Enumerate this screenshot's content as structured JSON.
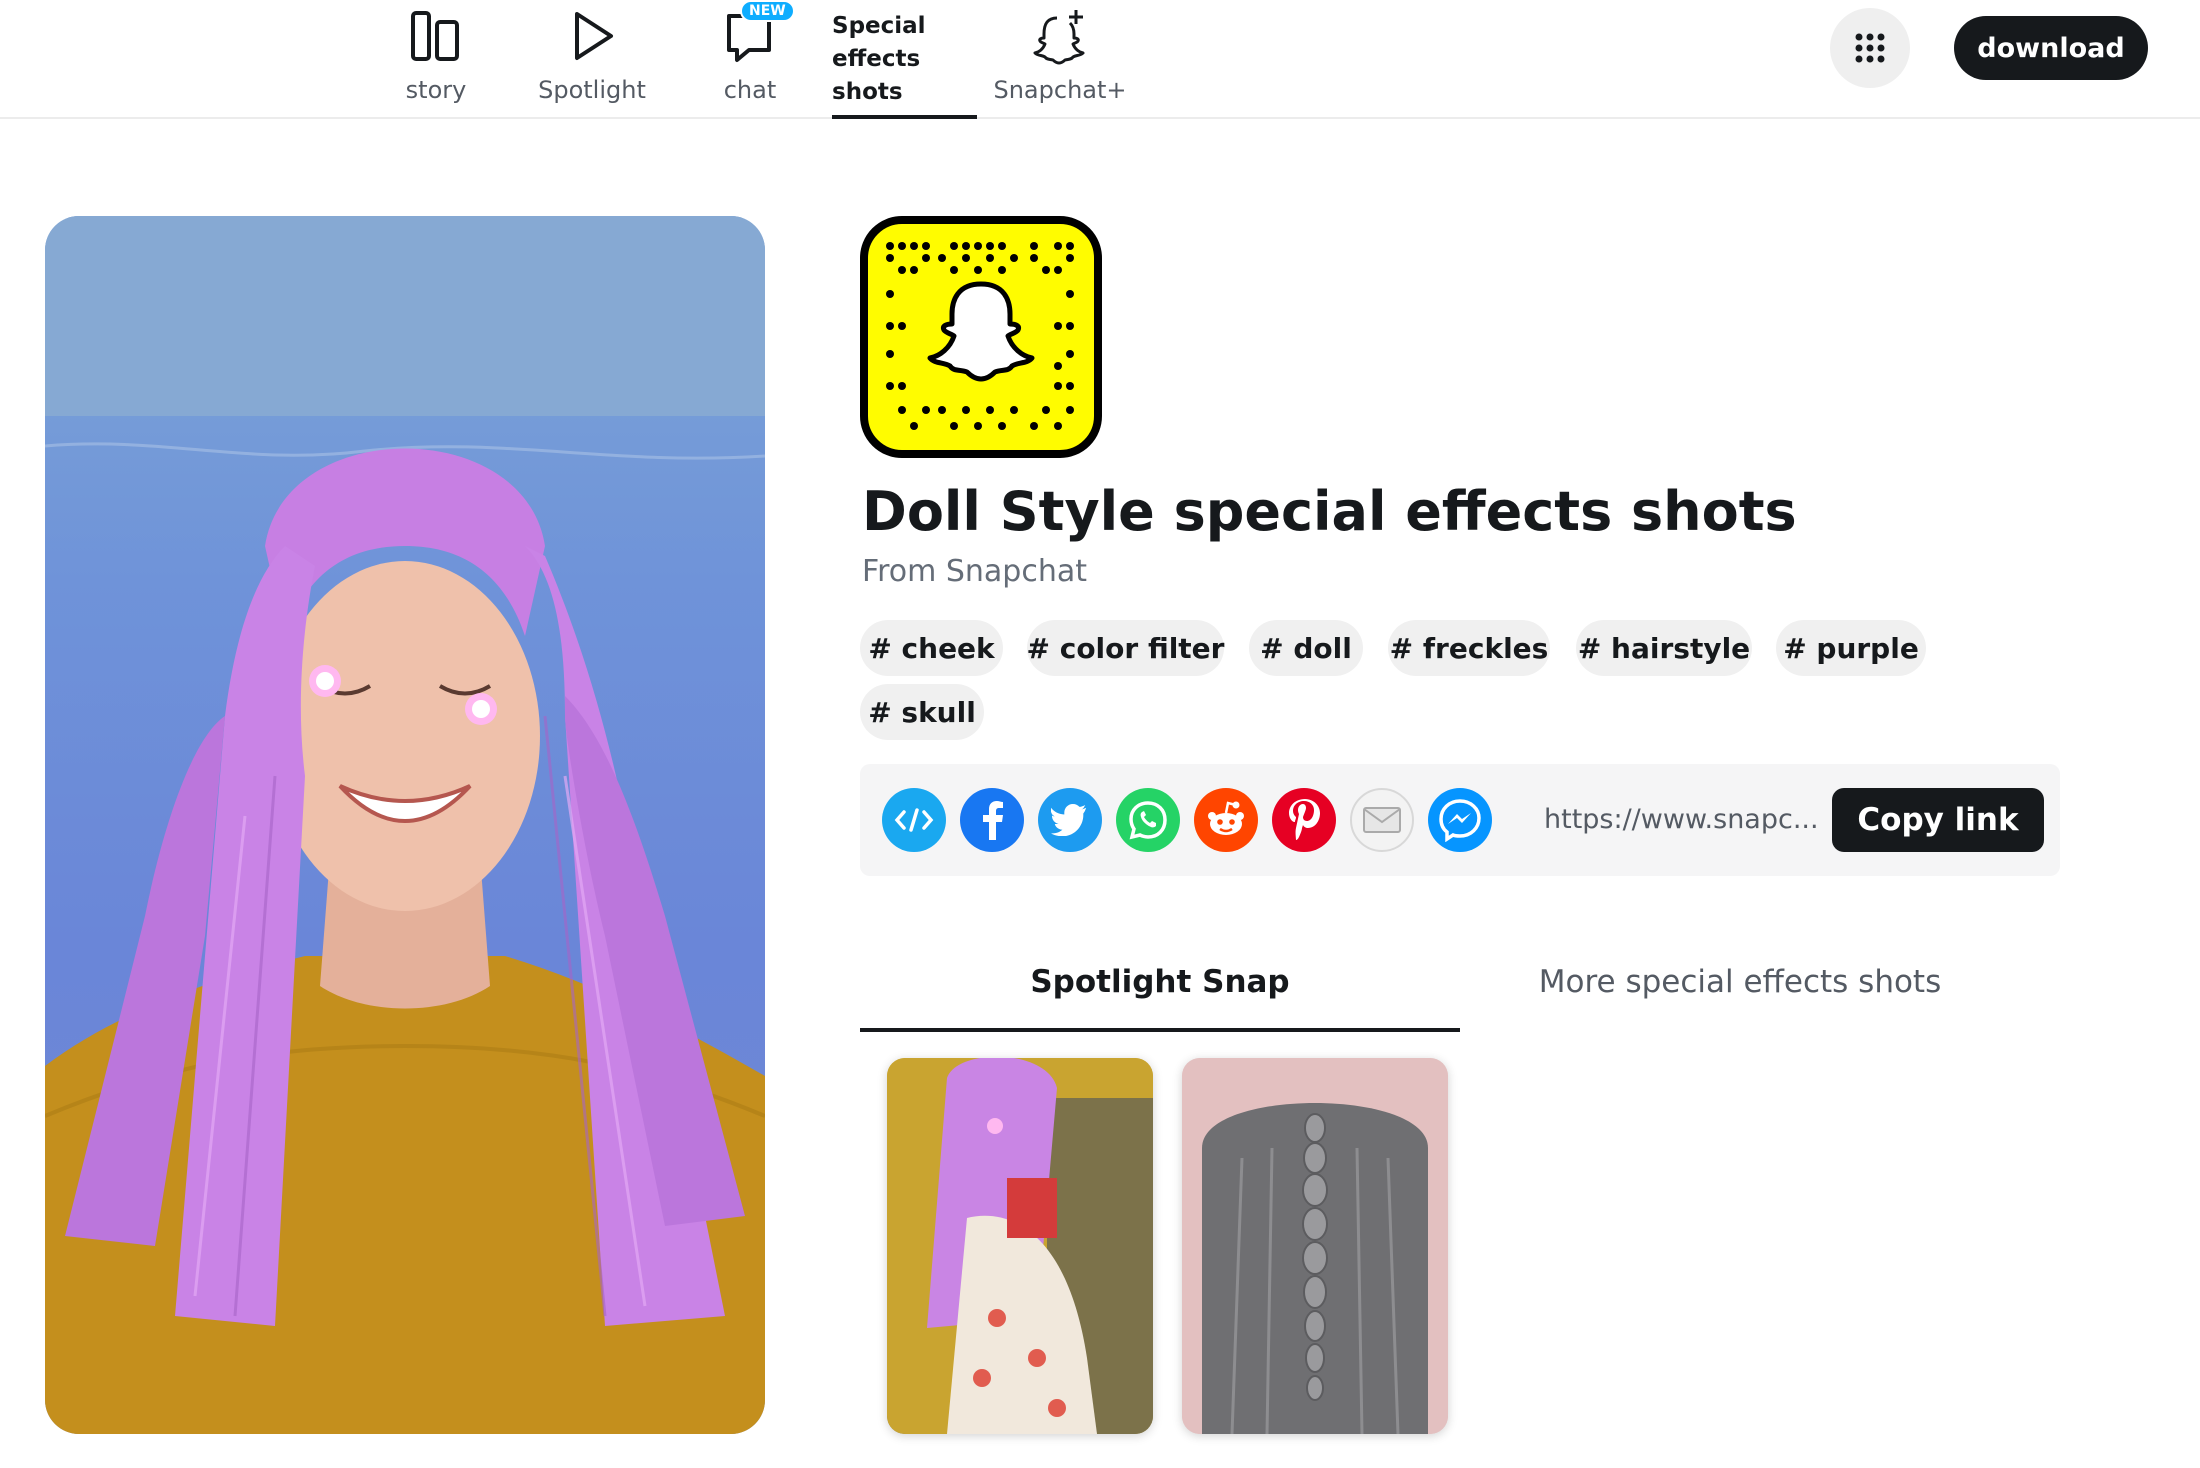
{
  "nav": {
    "items": [
      {
        "label": "story",
        "icon": "stories-icon"
      },
      {
        "label": "Spotlight",
        "icon": "play-icon"
      },
      {
        "label": "chat",
        "icon": "chat-icon",
        "badge": "NEW"
      },
      {
        "label": "Special effects shots",
        "icon": "",
        "active": true
      },
      {
        "label": "Snapchat+",
        "icon": "ghost-plus-icon"
      }
    ],
    "apps_icon": "grid-icon",
    "download_label": "download"
  },
  "lens": {
    "title": "Doll Style special effects shots",
    "author": "From Snapchat",
    "tags": [
      "# cheek",
      "# color filter",
      "# doll",
      "# freckles",
      "# hairstyle",
      "# purple",
      "# skull"
    ]
  },
  "share": {
    "icons": [
      "embed-icon",
      "facebook-icon",
      "twitter-icon",
      "whatsapp-icon",
      "reddit-icon",
      "pinterest-icon",
      "email-icon",
      "messenger-icon"
    ],
    "url": "https://www.snapc...",
    "copy_label": "Copy link"
  },
  "tabs": {
    "active": "Spotlight Snap",
    "inactive": "More special effects shots"
  },
  "colors": {
    "snap_yellow": "#fffc00",
    "dark": "#16191c",
    "badge_blue": "#0eadff"
  }
}
